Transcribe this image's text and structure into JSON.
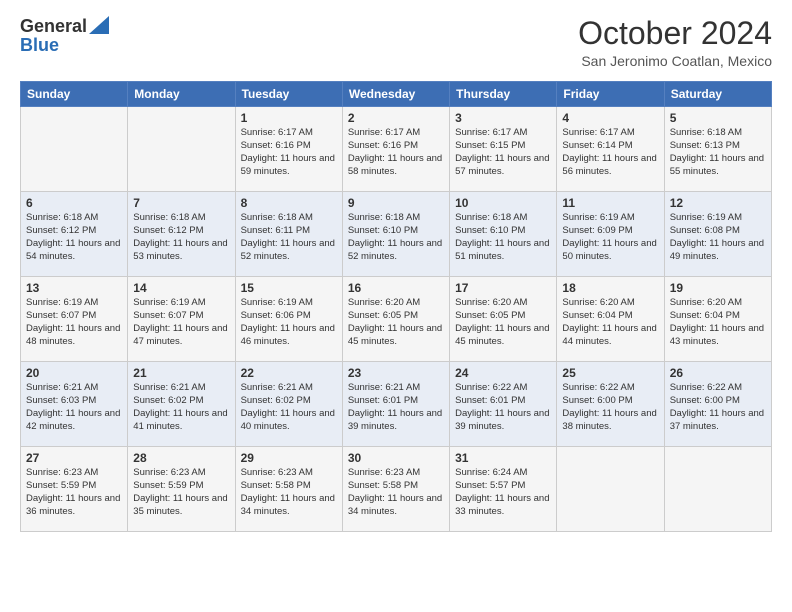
{
  "logo": {
    "line1": "General",
    "line2": "Blue",
    "tagline": ""
  },
  "header": {
    "month_year": "October 2024",
    "location": "San Jeronimo Coatlan, Mexico"
  },
  "days_of_week": [
    "Sunday",
    "Monday",
    "Tuesday",
    "Wednesday",
    "Thursday",
    "Friday",
    "Saturday"
  ],
  "weeks": [
    [
      {
        "day": "",
        "info": ""
      },
      {
        "day": "",
        "info": ""
      },
      {
        "day": "1",
        "info": "Sunrise: 6:17 AM\nSunset: 6:16 PM\nDaylight: 11 hours and 59 minutes."
      },
      {
        "day": "2",
        "info": "Sunrise: 6:17 AM\nSunset: 6:16 PM\nDaylight: 11 hours and 58 minutes."
      },
      {
        "day": "3",
        "info": "Sunrise: 6:17 AM\nSunset: 6:15 PM\nDaylight: 11 hours and 57 minutes."
      },
      {
        "day": "4",
        "info": "Sunrise: 6:17 AM\nSunset: 6:14 PM\nDaylight: 11 hours and 56 minutes."
      },
      {
        "day": "5",
        "info": "Sunrise: 6:18 AM\nSunset: 6:13 PM\nDaylight: 11 hours and 55 minutes."
      }
    ],
    [
      {
        "day": "6",
        "info": "Sunrise: 6:18 AM\nSunset: 6:12 PM\nDaylight: 11 hours and 54 minutes."
      },
      {
        "day": "7",
        "info": "Sunrise: 6:18 AM\nSunset: 6:12 PM\nDaylight: 11 hours and 53 minutes."
      },
      {
        "day": "8",
        "info": "Sunrise: 6:18 AM\nSunset: 6:11 PM\nDaylight: 11 hours and 52 minutes."
      },
      {
        "day": "9",
        "info": "Sunrise: 6:18 AM\nSunset: 6:10 PM\nDaylight: 11 hours and 52 minutes."
      },
      {
        "day": "10",
        "info": "Sunrise: 6:18 AM\nSunset: 6:10 PM\nDaylight: 11 hours and 51 minutes."
      },
      {
        "day": "11",
        "info": "Sunrise: 6:19 AM\nSunset: 6:09 PM\nDaylight: 11 hours and 50 minutes."
      },
      {
        "day": "12",
        "info": "Sunrise: 6:19 AM\nSunset: 6:08 PM\nDaylight: 11 hours and 49 minutes."
      }
    ],
    [
      {
        "day": "13",
        "info": "Sunrise: 6:19 AM\nSunset: 6:07 PM\nDaylight: 11 hours and 48 minutes."
      },
      {
        "day": "14",
        "info": "Sunrise: 6:19 AM\nSunset: 6:07 PM\nDaylight: 11 hours and 47 minutes."
      },
      {
        "day": "15",
        "info": "Sunrise: 6:19 AM\nSunset: 6:06 PM\nDaylight: 11 hours and 46 minutes."
      },
      {
        "day": "16",
        "info": "Sunrise: 6:20 AM\nSunset: 6:05 PM\nDaylight: 11 hours and 45 minutes."
      },
      {
        "day": "17",
        "info": "Sunrise: 6:20 AM\nSunset: 6:05 PM\nDaylight: 11 hours and 45 minutes."
      },
      {
        "day": "18",
        "info": "Sunrise: 6:20 AM\nSunset: 6:04 PM\nDaylight: 11 hours and 44 minutes."
      },
      {
        "day": "19",
        "info": "Sunrise: 6:20 AM\nSunset: 6:04 PM\nDaylight: 11 hours and 43 minutes."
      }
    ],
    [
      {
        "day": "20",
        "info": "Sunrise: 6:21 AM\nSunset: 6:03 PM\nDaylight: 11 hours and 42 minutes."
      },
      {
        "day": "21",
        "info": "Sunrise: 6:21 AM\nSunset: 6:02 PM\nDaylight: 11 hours and 41 minutes."
      },
      {
        "day": "22",
        "info": "Sunrise: 6:21 AM\nSunset: 6:02 PM\nDaylight: 11 hours and 40 minutes."
      },
      {
        "day": "23",
        "info": "Sunrise: 6:21 AM\nSunset: 6:01 PM\nDaylight: 11 hours and 39 minutes."
      },
      {
        "day": "24",
        "info": "Sunrise: 6:22 AM\nSunset: 6:01 PM\nDaylight: 11 hours and 39 minutes."
      },
      {
        "day": "25",
        "info": "Sunrise: 6:22 AM\nSunset: 6:00 PM\nDaylight: 11 hours and 38 minutes."
      },
      {
        "day": "26",
        "info": "Sunrise: 6:22 AM\nSunset: 6:00 PM\nDaylight: 11 hours and 37 minutes."
      }
    ],
    [
      {
        "day": "27",
        "info": "Sunrise: 6:23 AM\nSunset: 5:59 PM\nDaylight: 11 hours and 36 minutes."
      },
      {
        "day": "28",
        "info": "Sunrise: 6:23 AM\nSunset: 5:59 PM\nDaylight: 11 hours and 35 minutes."
      },
      {
        "day": "29",
        "info": "Sunrise: 6:23 AM\nSunset: 5:58 PM\nDaylight: 11 hours and 34 minutes."
      },
      {
        "day": "30",
        "info": "Sunrise: 6:23 AM\nSunset: 5:58 PM\nDaylight: 11 hours and 34 minutes."
      },
      {
        "day": "31",
        "info": "Sunrise: 6:24 AM\nSunset: 5:57 PM\nDaylight: 11 hours and 33 minutes."
      },
      {
        "day": "",
        "info": ""
      },
      {
        "day": "",
        "info": ""
      }
    ]
  ]
}
